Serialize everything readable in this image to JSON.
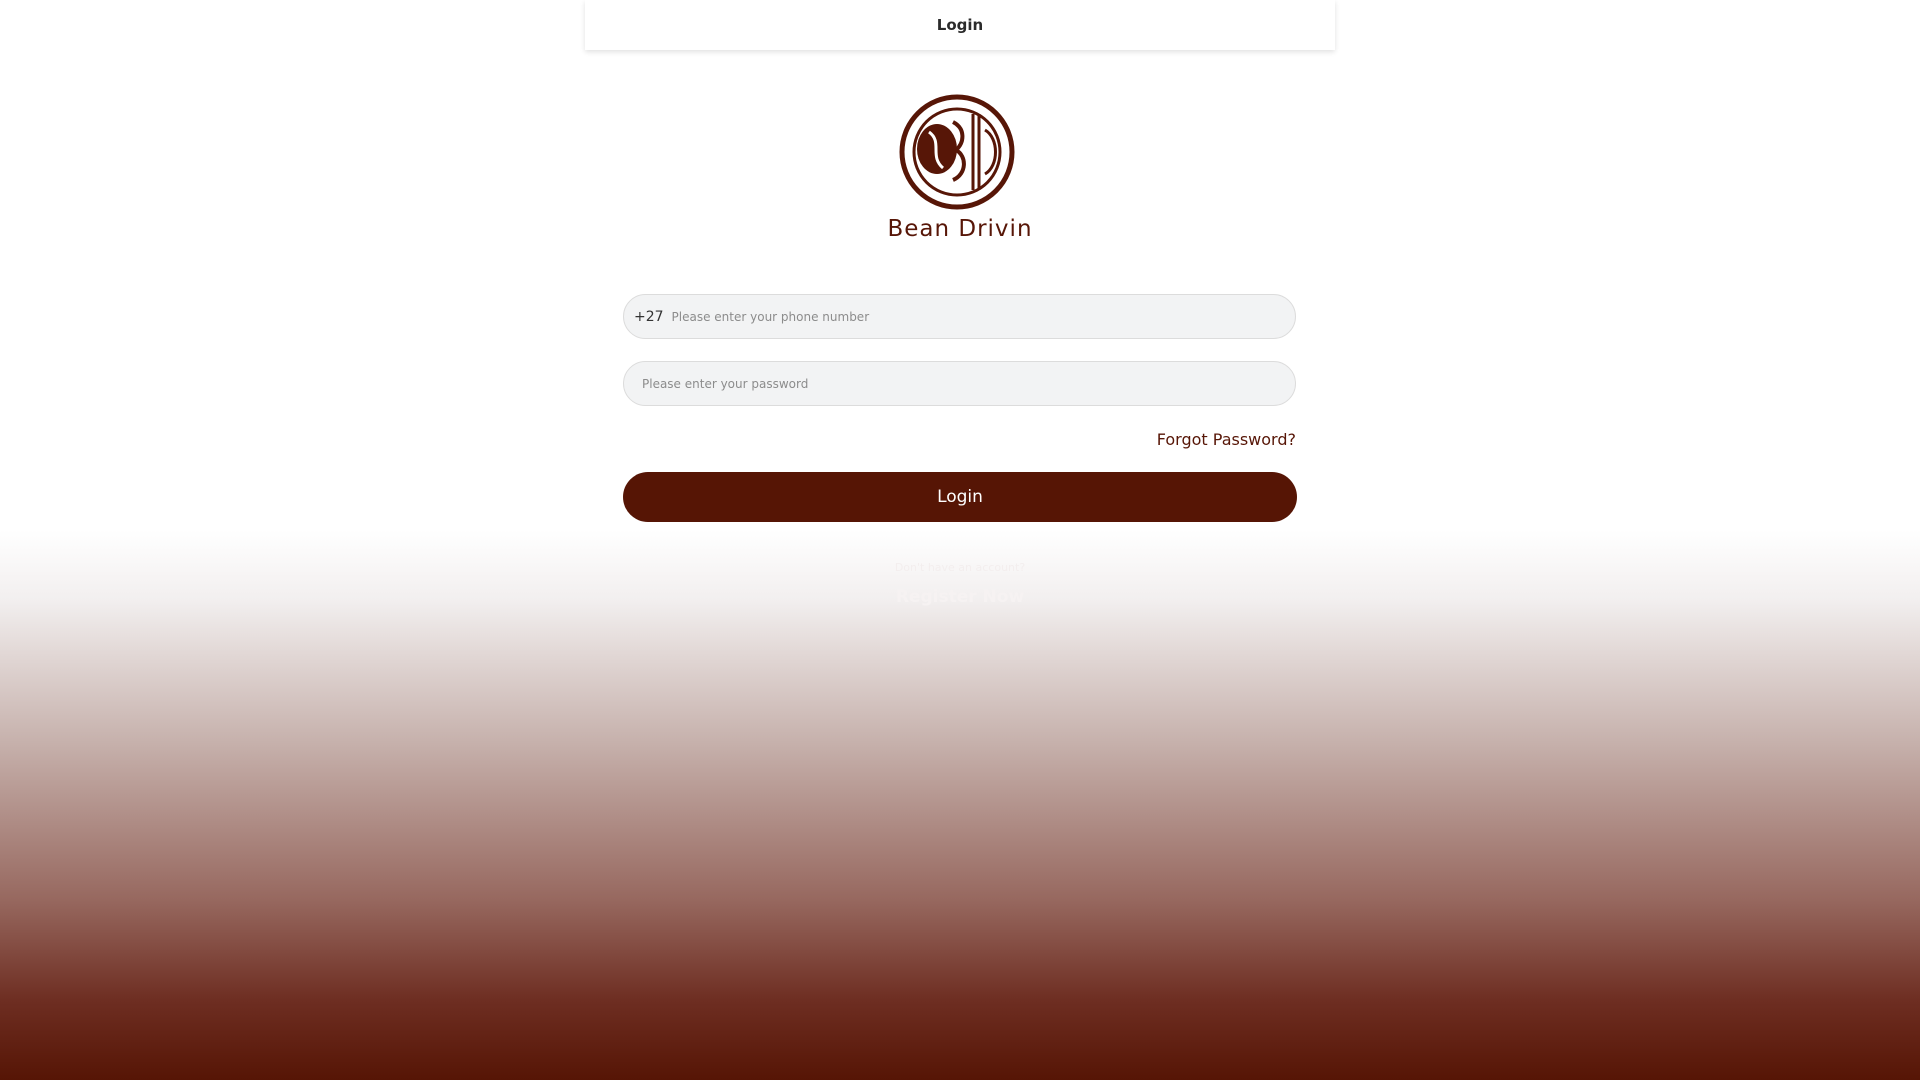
{
  "header": {
    "title": "Login"
  },
  "brand": {
    "name": "Bean Drivin",
    "logo_icon": "bean-drivin-logo",
    "color": "#561505"
  },
  "form": {
    "phone": {
      "country_code": "+27",
      "placeholder": "Please enter your phone number",
      "value": ""
    },
    "password": {
      "placeholder": "Please enter your password",
      "value": ""
    },
    "forgot_label": "Forgot Password?",
    "login_label": "Login"
  },
  "footer": {
    "no_account_text": "Don't have an account?",
    "register_label": "Register Now"
  }
}
